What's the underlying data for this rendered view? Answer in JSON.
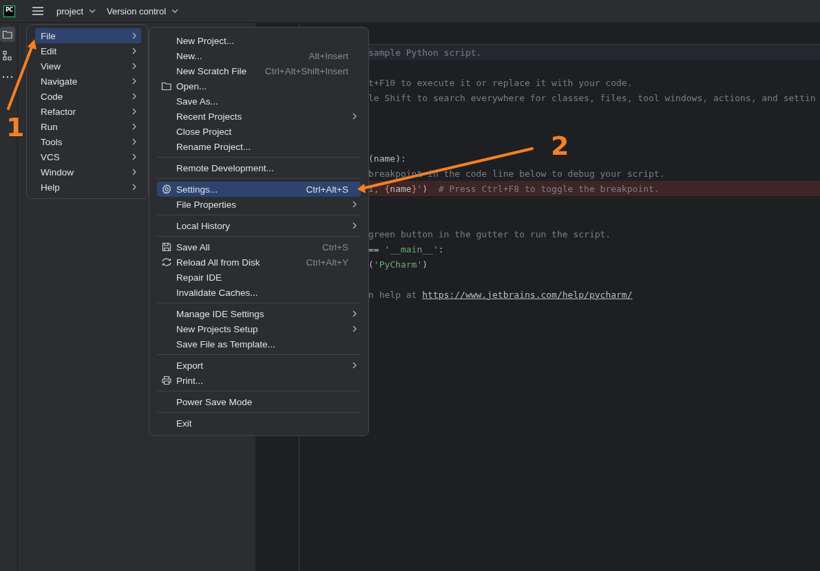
{
  "toolbar": {
    "logo": "PC",
    "project": "project",
    "vcs": "Version control"
  },
  "tool_strip": [
    {
      "kind": "folder",
      "selected": true
    },
    {
      "kind": "structure",
      "selected": false
    },
    {
      "kind": "more",
      "selected": false
    }
  ],
  "main_menu": [
    {
      "label": "File",
      "selected": true,
      "submenu": true
    },
    {
      "label": "Edit",
      "selected": false,
      "submenu": true
    },
    {
      "label": "View",
      "selected": false,
      "submenu": true
    },
    {
      "label": "Navigate",
      "selected": false,
      "submenu": true
    },
    {
      "label": "Code",
      "selected": false,
      "submenu": true
    },
    {
      "label": "Refactor",
      "selected": false,
      "submenu": true
    },
    {
      "label": "Run",
      "selected": false,
      "submenu": true
    },
    {
      "label": "Tools",
      "selected": false,
      "submenu": true
    },
    {
      "label": "VCS",
      "selected": false,
      "submenu": true
    },
    {
      "label": "Window",
      "selected": false,
      "submenu": true
    },
    {
      "label": "Help",
      "selected": false,
      "submenu": true
    }
  ],
  "file_menu": [
    {
      "kind": "item",
      "label": "New Project...",
      "selected": false
    },
    {
      "kind": "item",
      "label": "New...",
      "shortcut": "Alt+Insert",
      "selected": false
    },
    {
      "kind": "item",
      "label": "New Scratch File",
      "shortcut": "Ctrl+Alt+Shift+Insert",
      "selected": false
    },
    {
      "kind": "folder",
      "label": "Open...",
      "selected": false
    },
    {
      "kind": "item",
      "label": "Save As...",
      "selected": false
    },
    {
      "kind": "item",
      "label": "Recent Projects",
      "submenu": true,
      "selected": false
    },
    {
      "kind": "item",
      "label": "Close Project",
      "selected": false
    },
    {
      "kind": "item",
      "label": "Rename Project...",
      "selected": false
    },
    {
      "kind": "separator"
    },
    {
      "kind": "item",
      "label": "Remote Development...",
      "selected": false
    },
    {
      "kind": "separator"
    },
    {
      "kind": "gear",
      "label": "Settings...",
      "shortcut": "Ctrl+Alt+S",
      "selected": true
    },
    {
      "kind": "item",
      "label": "File Properties",
      "submenu": true,
      "selected": false
    },
    {
      "kind": "separator"
    },
    {
      "kind": "item",
      "label": "Local History",
      "submenu": true,
      "selected": false
    },
    {
      "kind": "separator"
    },
    {
      "kind": "disk",
      "label": "Save All",
      "shortcut": "Ctrl+S",
      "selected": false
    },
    {
      "kind": "reload",
      "label": "Reload All from Disk",
      "shortcut": "Ctrl+Alt+Y",
      "selected": false
    },
    {
      "kind": "item",
      "label": "Repair IDE",
      "selected": false
    },
    {
      "kind": "item",
      "label": "Invalidate Caches...",
      "selected": false
    },
    {
      "kind": "separator"
    },
    {
      "kind": "item",
      "label": "Manage IDE Settings",
      "submenu": true,
      "selected": false
    },
    {
      "kind": "item",
      "label": "New Projects Setup",
      "submenu": true,
      "selected": false
    },
    {
      "kind": "item",
      "label": "Save File as Template...",
      "selected": false
    },
    {
      "kind": "separator"
    },
    {
      "kind": "item",
      "label": "Export",
      "submenu": true,
      "selected": false
    },
    {
      "kind": "printer",
      "label": "Print...",
      "selected": false
    },
    {
      "kind": "separator"
    },
    {
      "kind": "item",
      "label": "Power Save Mode",
      "selected": false
    },
    {
      "kind": "separator"
    },
    {
      "kind": "item",
      "label": "Exit",
      "selected": false
    }
  ],
  "editor": {
    "lines": [
      {
        "kind": "code",
        "current": true,
        "breakpoint": false,
        "spans": [
          {
            "color": "#7a7e85",
            "text": "sample Python script."
          }
        ]
      },
      {
        "kind": "blank"
      },
      {
        "kind": "code",
        "current": false,
        "breakpoint": false,
        "spans": [
          {
            "color": "#7a7e85",
            "text": "t+F10 to execute it or replace it with your code."
          }
        ]
      },
      {
        "kind": "code",
        "current": false,
        "breakpoint": false,
        "spans": [
          {
            "color": "#7a7e85",
            "text": "le Shift to search everywhere for classes, files, tool windows, actions, and settin"
          }
        ]
      },
      {
        "kind": "blank"
      },
      {
        "kind": "blank"
      },
      {
        "kind": "blank"
      },
      {
        "kind": "code",
        "current": false,
        "breakpoint": false,
        "spans": [
          {
            "text": "(name):"
          }
        ]
      },
      {
        "kind": "code",
        "current": false,
        "breakpoint": false,
        "spans": [
          {
            "color": "#7a7e85",
            "text": "breakpoint in the code line below to debug your script."
          }
        ]
      },
      {
        "kind": "code",
        "current": false,
        "breakpoint": true,
        "spans": [
          {
            "color": "#6aab73",
            "text": "i, "
          },
          {
            "color": "#cf8e6d",
            "text": "{"
          },
          {
            "text": "name"
          },
          {
            "color": "#cf8e6d",
            "text": "}"
          },
          {
            "color": "#6aab73",
            "text": "'"
          },
          {
            "text": ")"
          },
          {
            "color": "#7a7e85",
            "text": "  # Press Ctrl+F8 to toggle the breakpoint."
          }
        ]
      },
      {
        "kind": "blank"
      },
      {
        "kind": "blank"
      },
      {
        "kind": "code",
        "current": false,
        "breakpoint": false,
        "spans": [
          {
            "color": "#7a7e85",
            "text": "green button in the gutter to run the script."
          }
        ]
      },
      {
        "kind": "code",
        "current": false,
        "breakpoint": false,
        "spans": [
          {
            "text": "== "
          },
          {
            "color": "#6aab73",
            "text": "'__main__'"
          },
          {
            "text": ":"
          }
        ]
      },
      {
        "kind": "code",
        "current": false,
        "breakpoint": false,
        "spans": [
          {
            "text": "("
          },
          {
            "color": "#6aab73",
            "text": "'PyCharm'"
          },
          {
            "text": ")"
          }
        ]
      },
      {
        "kind": "blank"
      },
      {
        "kind": "code",
        "current": false,
        "breakpoint": false,
        "spans": [
          {
            "color": "#7a7e85",
            "text": "n help at "
          },
          {
            "text": "https://www.jetbrains.com/help/pycharm/",
            "link": true
          }
        ]
      }
    ]
  },
  "annotations": [
    {
      "label": "1"
    },
    {
      "label": "2"
    }
  ]
}
